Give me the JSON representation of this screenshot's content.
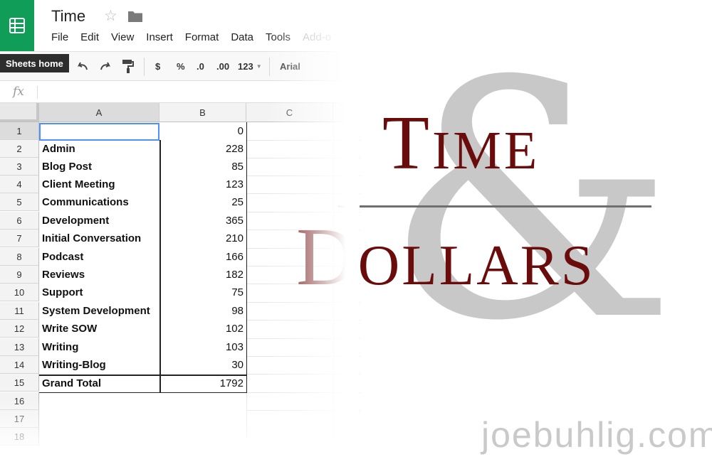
{
  "app": {
    "title": "Time",
    "home_tooltip": "Sheets home",
    "menu": [
      "File",
      "Edit",
      "View",
      "Insert",
      "Format",
      "Data",
      "Tools",
      "Add-o"
    ],
    "toolbar": {
      "currency": "$",
      "percent": "%",
      "decrease_decimals": ".0",
      "increase_decimals": ".00",
      "more_formats": "123",
      "font": "Arial"
    },
    "formula_label": "fx",
    "columns": [
      "A",
      "B",
      "C"
    ],
    "rows": [
      {
        "num": "1",
        "a": "",
        "b": "0"
      },
      {
        "num": "2",
        "a": "Admin",
        "b": "228"
      },
      {
        "num": "3",
        "a": "Blog Post",
        "b": "85"
      },
      {
        "num": "4",
        "a": "Client Meeting",
        "b": "123"
      },
      {
        "num": "5",
        "a": "Communications",
        "b": "25"
      },
      {
        "num": "6",
        "a": "Development",
        "b": "365"
      },
      {
        "num": "7",
        "a": "Initial Conversation",
        "b": "210"
      },
      {
        "num": "8",
        "a": "Podcast",
        "b": "166"
      },
      {
        "num": "9",
        "a": "Reviews",
        "b": "182"
      },
      {
        "num": "10",
        "a": "Support",
        "b": "75"
      },
      {
        "num": "11",
        "a": "System Development",
        "b": "98"
      },
      {
        "num": "12",
        "a": "Write SOW",
        "b": "102"
      },
      {
        "num": "13",
        "a": "Writing",
        "b": "103"
      },
      {
        "num": "14",
        "a": "Writing-Blog",
        "b": "30"
      },
      {
        "num": "15",
        "a": "Grand Total",
        "b": "1792"
      },
      {
        "num": "16",
        "a": "",
        "b": ""
      },
      {
        "num": "17",
        "a": "",
        "b": ""
      },
      {
        "num": "18",
        "a": "",
        "b": ""
      }
    ]
  },
  "branding": {
    "line1": "Time",
    "ampersand": "&",
    "line2": "Dollars",
    "site": "joebuhlig.com",
    "accent_color": "#6b0c0c",
    "sheets_green": "#0f9d58"
  }
}
